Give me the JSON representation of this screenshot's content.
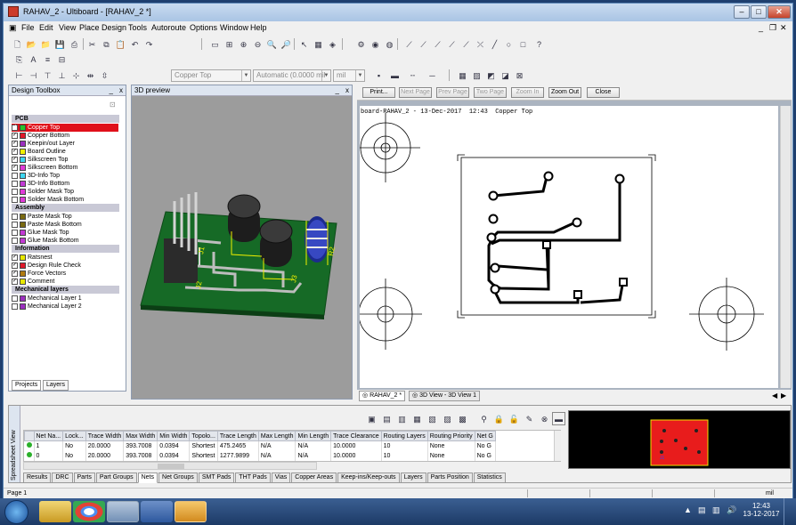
{
  "window": {
    "title": "RAHAV_2 - Ultiboard - [RAHAV_2 *]",
    "minimize": "–",
    "maximize": "□",
    "close": "✕"
  },
  "menu": [
    "File",
    "Edit",
    "View",
    "Place",
    "Design",
    "Tools",
    "Autoroute",
    "Options",
    "Window",
    "Help"
  ],
  "toolbar3": {
    "layer_select": "Copper Top",
    "width_select": "Automatic (0.0000 mil",
    "unit_select": "mil"
  },
  "design_toolbox": {
    "title": "Design Toolbox",
    "groups": [
      {
        "label": "PCB",
        "items": [
          {
            "label": "Copper Top",
            "color": "#28c428",
            "checked": true,
            "selected": true
          },
          {
            "label": "Copper Bottom",
            "color": "#e0192a",
            "checked": true
          },
          {
            "label": "Keepin/out Layer",
            "color": "#9c2fbf",
            "checked": true
          },
          {
            "label": "Board Outline",
            "color": "#f0f000",
            "checked": true
          },
          {
            "label": "Silkscreen Top",
            "color": "#3cd6f0",
            "checked": true
          },
          {
            "label": "Silkscreen Bottom",
            "color": "#e03ad8",
            "checked": true
          },
          {
            "label": "3D-Info Top",
            "color": "#3cd6f0",
            "checked": false
          },
          {
            "label": "3D-Info Bottom",
            "color": "#c23ad4",
            "checked": false
          },
          {
            "label": "Solder Mask Top",
            "color": "#e03ad8",
            "checked": false
          },
          {
            "label": "Solder Mask Bottom",
            "color": "#e03ad8",
            "checked": false
          }
        ]
      },
      {
        "label": "Assembly",
        "items": [
          {
            "label": "Paste Mask Top",
            "color": "#7a6a10",
            "checked": false
          },
          {
            "label": "Paste Mask Bottom",
            "color": "#7a6a10",
            "checked": false
          },
          {
            "label": "Glue Mask Top",
            "color": "#c23ad4",
            "checked": false
          },
          {
            "label": "Glue Mask Bottom",
            "color": "#c23ad4",
            "checked": false
          }
        ]
      },
      {
        "label": "Information",
        "items": [
          {
            "label": "Ratsnest",
            "color": "#e8e800",
            "checked": true
          },
          {
            "label": "Design Rule Check",
            "color": "#e0192a",
            "checked": true
          },
          {
            "label": "Force Vectors",
            "color": "#b07a10",
            "checked": true
          },
          {
            "label": "Comment",
            "color": "#e8e800",
            "checked": true
          }
        ]
      },
      {
        "label": "Mechanical layers",
        "items": [
          {
            "label": "Mechanical Layer 1",
            "color": "#9c2fbf",
            "checked": false
          },
          {
            "label": "Mechanical Layer 2",
            "color": "#9c2fbf",
            "checked": false
          }
        ]
      }
    ],
    "tabs": [
      "Projects",
      "Layers"
    ]
  },
  "preview3d": {
    "title": "3D preview"
  },
  "print_preview": {
    "buttons": [
      {
        "label": "Print...",
        "enabled": true
      },
      {
        "label": "Next Page",
        "enabled": false
      },
      {
        "label": "Prev Page",
        "enabled": false
      },
      {
        "label": "Two Page",
        "enabled": false
      },
      {
        "label": "Zoom In",
        "enabled": false
      },
      {
        "label": "Zoom Out",
        "enabled": true
      },
      {
        "label": "Close",
        "enabled": true
      }
    ],
    "header_text": "board-RAHAV_2 - 13-Dec-2017  12:43  Copper Top"
  },
  "doc_tabs": [
    "RAHAV_2 *",
    "3D View - 3D View 1"
  ],
  "spreadsheet": {
    "side_label": "Spreadsheet View",
    "columns": [
      "Net Na...",
      "Lock...",
      "Trace Width",
      "Max Width",
      "Min Width",
      "Topolo...",
      "Trace Length",
      "Max Length",
      "Min Length",
      "Trace Clearance",
      "Routing Layers",
      "Routing Priority",
      "Net G"
    ],
    "rows": [
      [
        "1",
        "No",
        "20.0000",
        "393.7008",
        "0.0394",
        "Shortest",
        "475.2465",
        "N/A",
        "N/A",
        "10.0000",
        "10",
        "None",
        "No G"
      ],
      [
        "0",
        "No",
        "20.0000",
        "393.7008",
        "0.0394",
        "Shortest",
        "1277.9899",
        "N/A",
        "N/A",
        "10.0000",
        "10",
        "None",
        "No G"
      ]
    ],
    "tabs": [
      "Results",
      "DRC",
      "Parts",
      "Part Groups",
      "Nets",
      "Net Groups",
      "SMT Pads",
      "THT Pads",
      "Vias",
      "Copper Areas",
      "Keep-ins/Keep-outs",
      "Layers",
      "Parts Position",
      "Statistics"
    ],
    "active_tab": "Nets"
  },
  "status": {
    "left": "Page 1",
    "unit": "mil"
  },
  "taskbar": {
    "time": "12:43",
    "date": "13-12-2017"
  }
}
